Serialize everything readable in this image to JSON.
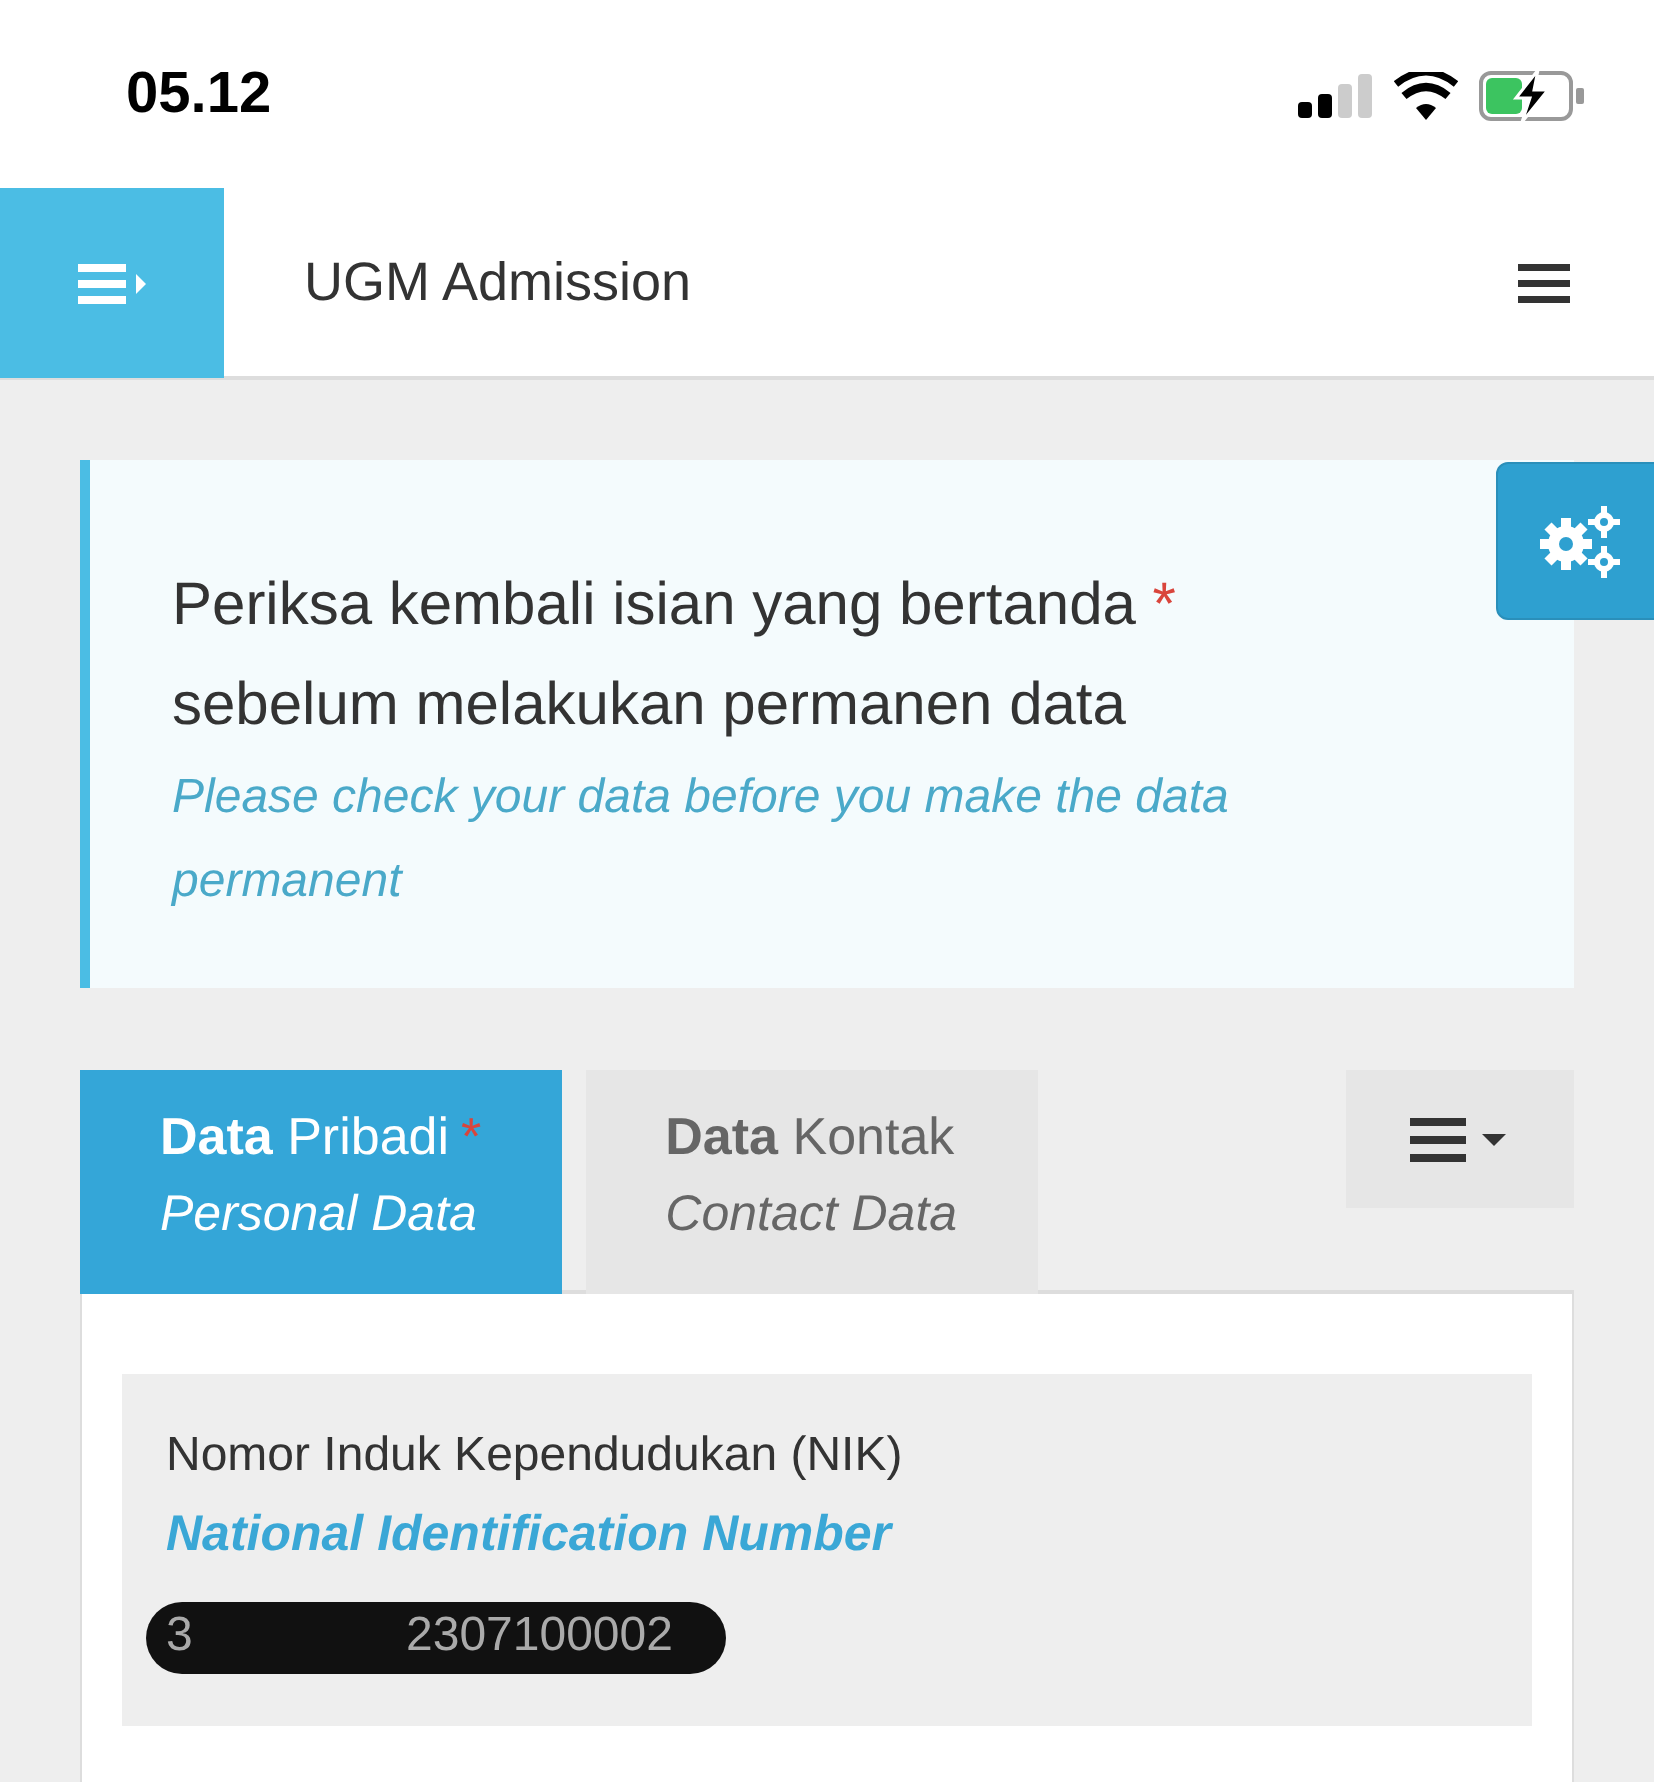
{
  "status_bar": {
    "time": "05.12"
  },
  "header": {
    "title": "UGM Admission"
  },
  "notice": {
    "heading": "Periksa kembali isian yang bertanda",
    "required_mark": "*",
    "heading_continued": "sebelum melakukan permanen data",
    "subtitle": "Please check your data before you make the data permanent"
  },
  "tabs": [
    {
      "label": "**Data** Pribadi",
      "required_mark": "*",
      "subtitle": "Personal Data",
      "selected": true
    },
    {
      "label": "**Data** Kontak",
      "subtitle": "Contact Data",
      "selected": false
    }
  ],
  "fields": [
    {
      "label": "Nomor Induk Kependudukan (NIK)",
      "sublabel": "National Identification Number",
      "value_start": "3",
      "value_end": "2307100002",
      "redacted": true
    }
  ]
}
